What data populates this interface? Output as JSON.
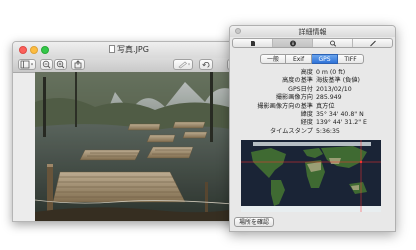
{
  "preview": {
    "title": "写真.JPG"
  },
  "info": {
    "title": "詳細情報",
    "icon_tabs": [
      "general-icon",
      "info-icon",
      "search-icon",
      "pen-icon"
    ],
    "tabs": [
      "一般",
      "Exif",
      "GPS",
      "TIFF"
    ],
    "active_tab": "GPS",
    "rows": [
      {
        "key": "高度",
        "value": "0 m (0 ft)"
      },
      {
        "key": "高度の基準",
        "value": "海抜基準 (負値)"
      },
      {
        "key": "GPS日付",
        "value": "2013/02/10"
      },
      {
        "key": "撮影画像方向",
        "value": "285.949"
      },
      {
        "key": "撮影画像方向の基準",
        "value": "真方位"
      },
      {
        "key": "緯度",
        "value": "35° 34' 40.8\" N"
      },
      {
        "key": "経度",
        "value": "139° 44' 31.2\" E"
      },
      {
        "key": "タイムスタンプ",
        "value": "5:36:35"
      }
    ],
    "locate_button": "場所を確認"
  },
  "colors": {
    "accent": "#2f73d8",
    "map_marker": "#ff3030"
  }
}
